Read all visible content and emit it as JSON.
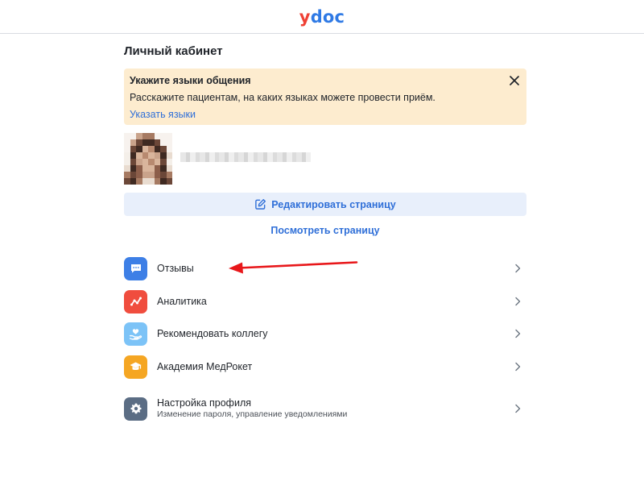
{
  "logo": {
    "part1": "y",
    "part2": "doc"
  },
  "page_title": "Личный кабинет",
  "banner": {
    "title": "Укажите языки общения",
    "text": "Расскажите пациентам, на каких языках можете провести приём.",
    "link": "Указать языки"
  },
  "actions": {
    "edit_label": "Редактировать страницу",
    "view_label": "Посмотреть страницу"
  },
  "menu": {
    "items": [
      {
        "label": "Отзывы",
        "icon": "chat-bubble-icon",
        "color": "#3d7fe6"
      },
      {
        "label": "Аналитика",
        "icon": "trend-line-icon",
        "color": "#f04d3e"
      },
      {
        "label": "Рекомендовать коллегу",
        "icon": "heart-hand-icon",
        "color": "#7cc3f7"
      },
      {
        "label": "Академия МедРокет",
        "icon": "graduation-cap-icon",
        "color": "#f5a623"
      },
      {
        "label": "Настройка профиля",
        "sublabel": "Изменение пароля, управление уведомлениями",
        "icon": "gear-icon",
        "color": "#5b6d84"
      }
    ]
  },
  "annotation": {
    "color": "#e8171a"
  }
}
